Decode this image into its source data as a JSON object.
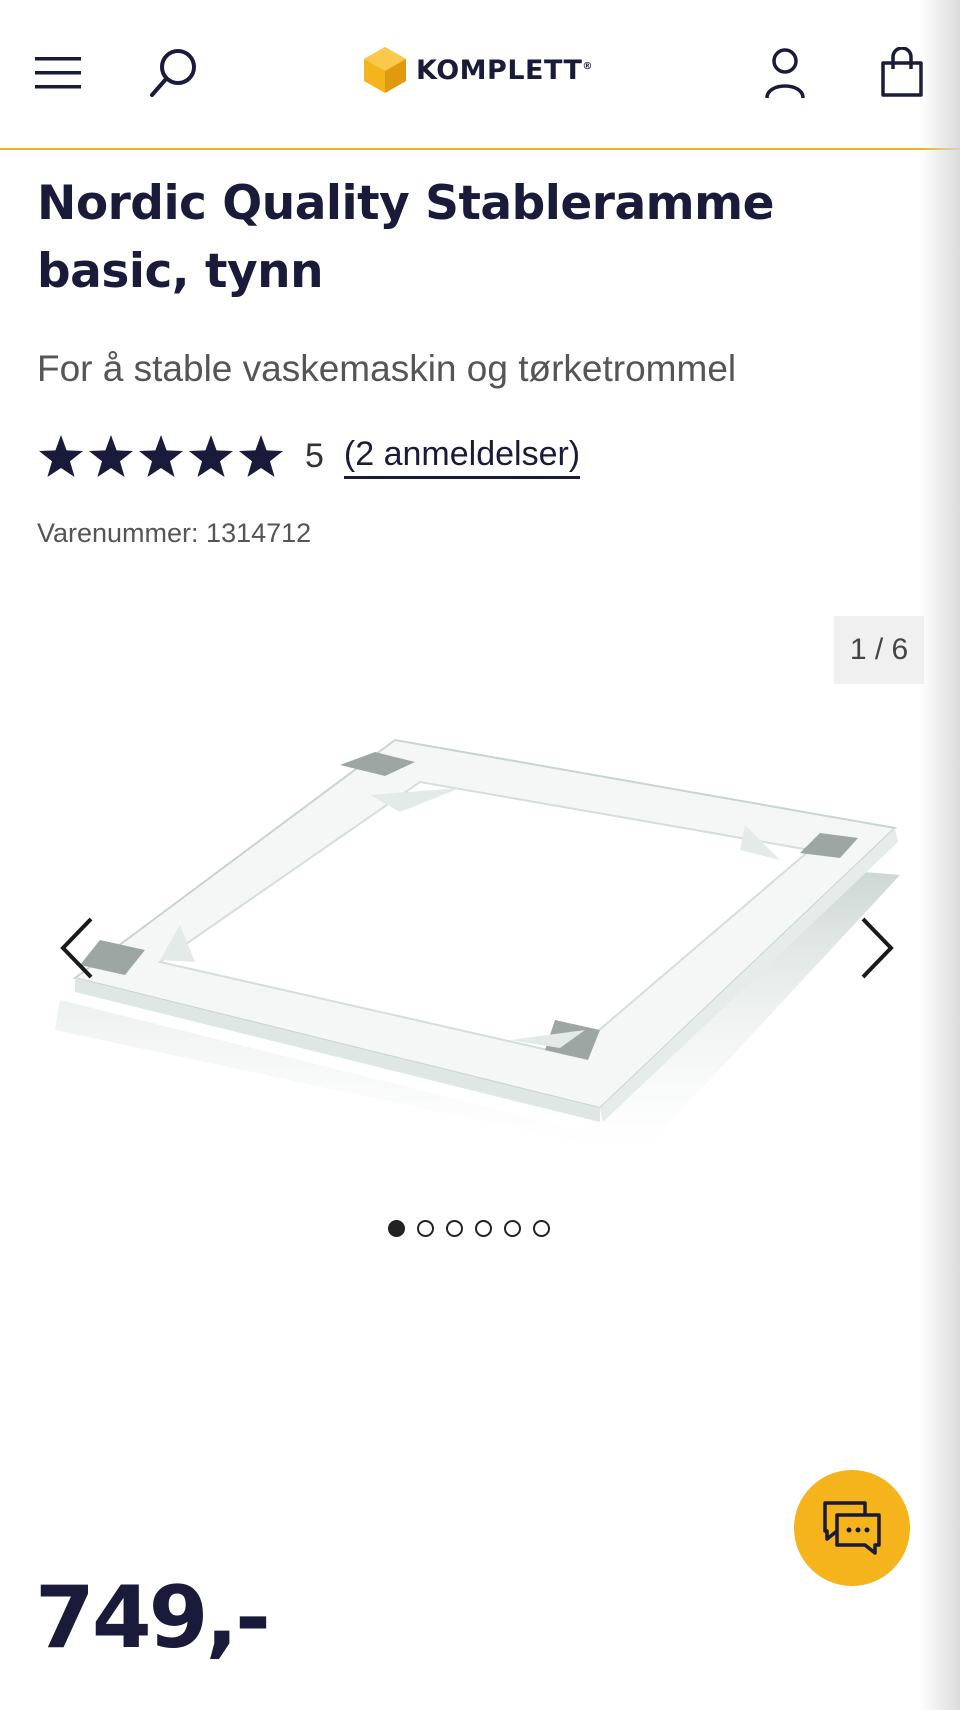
{
  "header": {
    "menu_icon": "hamburger-menu-icon",
    "search_icon": "search-icon",
    "logo_text": "KOMPLETT",
    "logo_mark": "®",
    "account_icon": "user-icon",
    "cart_icon": "shopping-bag-icon"
  },
  "product": {
    "title": "Nordic Quality Stableramme basic, tynn",
    "subtitle": "For å stable vaskemaskin og tørketrommel",
    "rating": {
      "stars": 5,
      "max_stars": 5,
      "value_text": "5",
      "reviews_text": "(2 anmeldelser)"
    },
    "sku_label": "Varenummer: 1314712",
    "price": "749,-"
  },
  "gallery": {
    "counter": "1 / 6",
    "current": 1,
    "total": 6,
    "prev_icon": "chevron-left-icon",
    "next_icon": "chevron-right-icon"
  },
  "chat": {
    "icon": "chat-bubbles-icon"
  },
  "colors": {
    "primary_text": "#1a1a3a",
    "accent": "#f5b41c",
    "header_border": "#e6b422"
  }
}
